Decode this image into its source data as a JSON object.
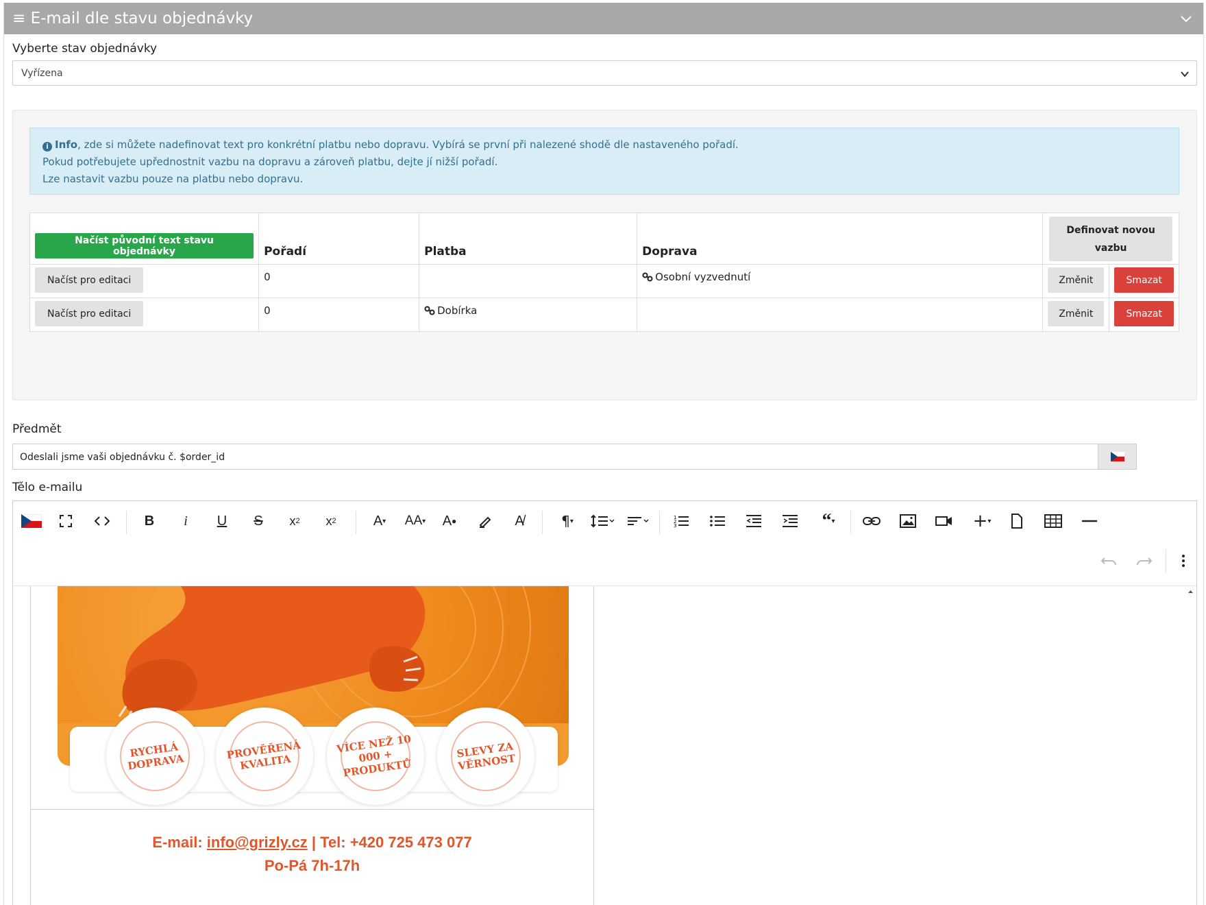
{
  "panel": {
    "title": "E-mail dle stavu objednávky"
  },
  "status": {
    "label": "Vyberte stav objednávky",
    "selected": "Vyřízena"
  },
  "info": {
    "strong": "Info",
    "line1": ", zde si můžete nadefinovat text pro konkrétní platbu nebo dopravu. Vybírá se první při nalezené shodě dle nastaveného pořadí.",
    "line2": "Pokud potřebujete upřednostnit vazbu na dopravu a zároveň platbu, dejte jí nižší pořadí.",
    "line3": "Lze nastavit vazbu pouze na platbu nebo dopravu."
  },
  "table": {
    "load_original_label": "Načíst původní text stavu objednávky",
    "columns": [
      "Pořadí",
      "Platba",
      "Doprava"
    ],
    "define_new_label": "Definovat novou vazbu",
    "rows": [
      {
        "edit_label": "Načíst pro editaci",
        "order": "0",
        "payment": "",
        "shipping": "Osobní vyzvednutí",
        "change_label": "Změnit",
        "delete_label": "Smazat"
      },
      {
        "edit_label": "Načíst pro editaci",
        "order": "0",
        "payment": "Dobírka",
        "shipping": "",
        "change_label": "Změnit",
        "delete_label": "Smazat"
      }
    ]
  },
  "subject": {
    "label": "Předmět",
    "value": "Odeslali jsme vaši objednávku č. $order_id"
  },
  "body": {
    "label": "Tělo e-mailu"
  },
  "toolbar": {
    "bold": "B",
    "italic": "i",
    "underline": "U",
    "strike": "S",
    "font_size": "A",
    "font_size_alt": "AA"
  },
  "email_preview": {
    "badges": [
      "RYCHLÁ DOPRAVA",
      "PROVĚŘENÁ KVALITA",
      "VÍCE NEŽ 10 000 + PRODUKTŮ",
      "SLEVY ZA VĚRNOST"
    ],
    "contact_prefix": "E-mail: ",
    "contact_email": "info@grizly.cz",
    "contact_suffix": " | Tel: +420 725 473 077",
    "hours": "Po-Pá 7h-17h"
  },
  "colors": {
    "header": "#a8a8a8",
    "success": "#2aa64a",
    "danger": "#d9413a",
    "info_bg": "#d9edf7",
    "brand_orange": "#ef8a1c",
    "brand_text": "#e0552a"
  }
}
